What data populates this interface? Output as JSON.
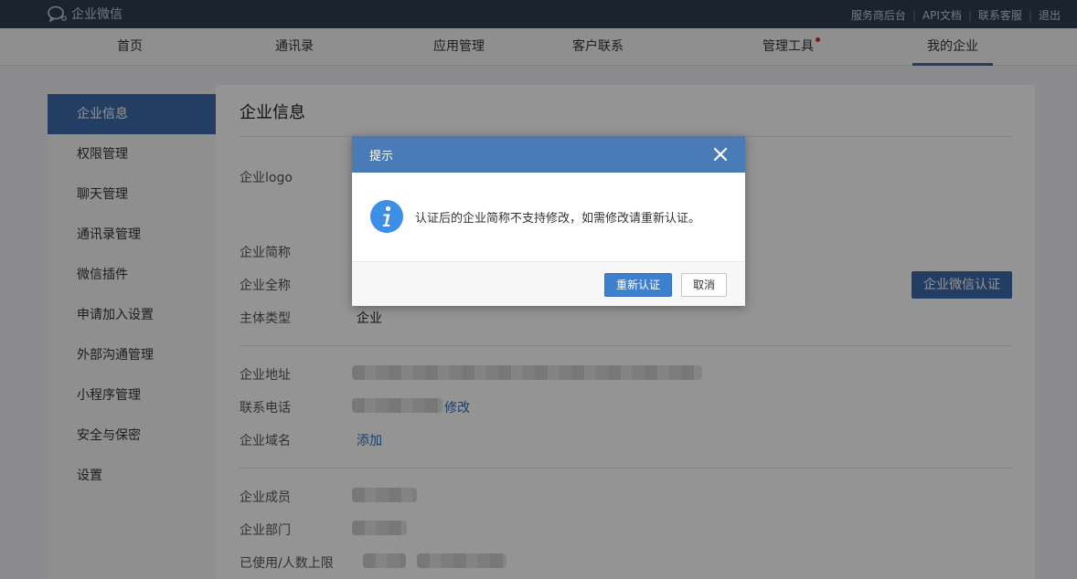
{
  "app": {
    "logo_text": "企业微信"
  },
  "toplinks": [
    "服务商后台",
    "API文档",
    "联系客服",
    "退出"
  ],
  "nav": [
    {
      "label": "首页"
    },
    {
      "label": "通讯录"
    },
    {
      "label": "应用管理"
    },
    {
      "label": "客户联系"
    },
    {
      "label": "管理工具"
    },
    {
      "label": "我的企业"
    }
  ],
  "sidebar": [
    "企业信息",
    "权限管理",
    "聊天管理",
    "通讯录管理",
    "微信插件",
    "申请加入设置",
    "外部沟通管理",
    "小程序管理",
    "安全与保密",
    "设置"
  ],
  "panel": {
    "title": "企业信息",
    "labels": {
      "logo": "企业logo",
      "short_name": "企业简称",
      "full_name": "企业全称",
      "entity_type": "主体类型",
      "address": "企业地址",
      "phone": "联系电话",
      "domain": "企业域名",
      "members": "企业成员",
      "departments": "企业部门",
      "usage": "已使用/人数上限"
    },
    "entity_type_value": "企业",
    "phone_action": "修改",
    "domain_action": "添加",
    "verify_button": "企业微信认证"
  },
  "dialog": {
    "title": "提示",
    "message": "认证后的企业简称不支持修改，如需修改请重新认证。",
    "confirm": "重新认证",
    "cancel": "取消"
  },
  "colors": {
    "topbar": "#2c3e50",
    "accent": "#3e6cab",
    "dialog_header": "#4a7bb7",
    "info_icon": "#3d8ee6",
    "notice_dot": "#d9252b"
  }
}
